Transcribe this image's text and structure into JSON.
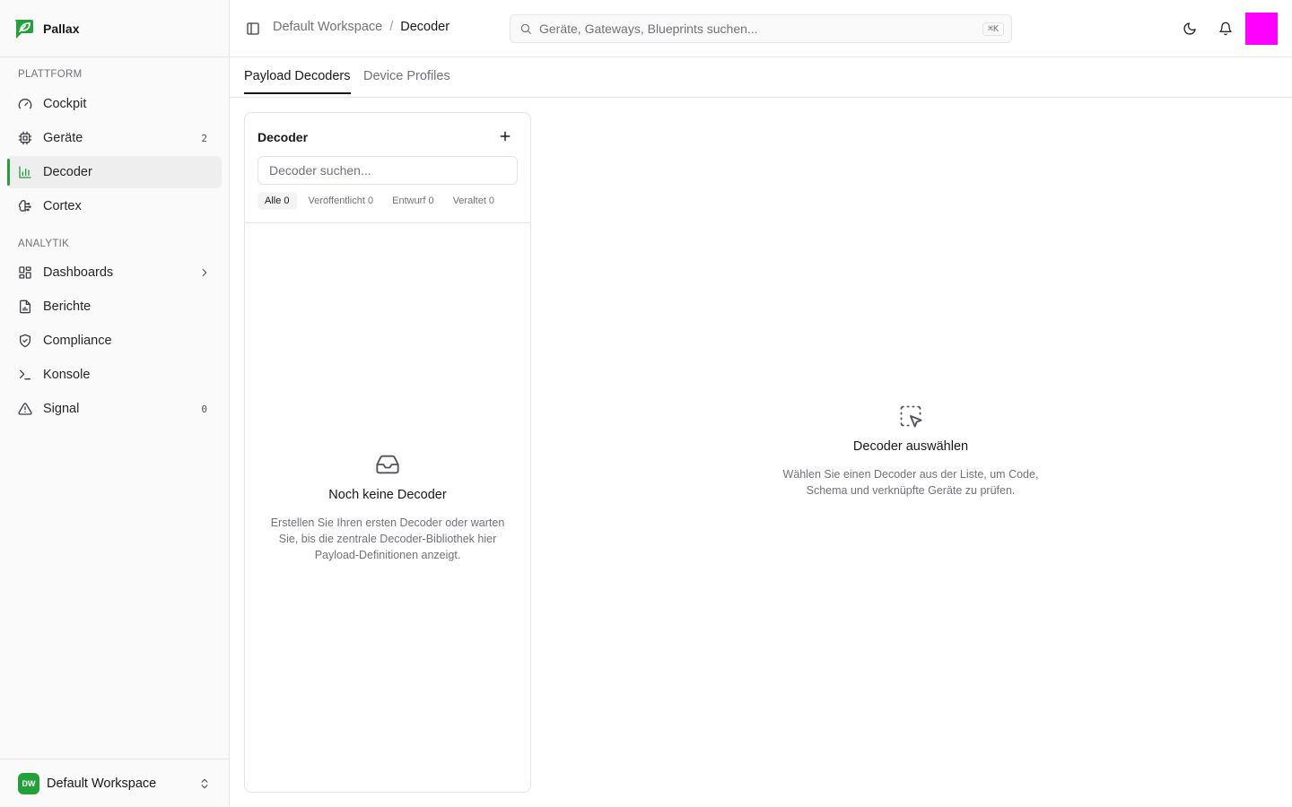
{
  "brand": {
    "name": "Pallax",
    "accent": "#22a13b"
  },
  "sidebar": {
    "sections": [
      {
        "label": "PLATTFORM"
      },
      {
        "label": "ANALYTIK"
      }
    ],
    "items": [
      {
        "label": "Cockpit",
        "icon": "gauge-icon"
      },
      {
        "label": "Geräte",
        "icon": "chip-icon",
        "count": "2"
      },
      {
        "label": "Decoder",
        "icon": "bar-chart-icon",
        "active": true
      },
      {
        "label": "Cortex",
        "icon": "brain-icon"
      },
      {
        "label": "Dashboards",
        "icon": "grid-icon"
      },
      {
        "label": "Berichte",
        "icon": "file-report-icon"
      },
      {
        "label": "Compliance",
        "icon": "shield-check-icon"
      },
      {
        "label": "Konsole",
        "icon": "terminal-icon"
      },
      {
        "label": "Signal",
        "icon": "warning-icon",
        "count": "0"
      }
    ],
    "workspace": {
      "initials": "DW",
      "name": "Default Workspace"
    }
  },
  "header": {
    "breadcrumb": [
      "Default Workspace",
      "Decoder"
    ],
    "breadcrumb_separator": "/",
    "search_placeholder": "Geräte, Gateways, Blueprints suchen...",
    "search_shortcut": "⌘K",
    "avatar_color": "#ff00ff"
  },
  "tabs": [
    {
      "label": "Payload Decoders",
      "active": true
    },
    {
      "label": "Device Profiles"
    }
  ],
  "decoder_panel": {
    "title": "Decoder",
    "search_placeholder": "Decoder suchen...",
    "filters": [
      "Alle 0",
      "Veröffentlicht 0",
      "Entwurf 0",
      "Veraltet 0"
    ],
    "empty_title": "Noch keine Decoder",
    "empty_description": "Erstellen Sie Ihren ersten Decoder oder warten Sie, bis die zentrale Decoder-Bibliothek hier Payload-Definitionen anzeigt."
  },
  "detail": {
    "title": "Decoder auswählen",
    "description": "Wählen Sie einen Decoder aus der Liste, um Code, Schema und verknüpfte Geräte zu prüfen."
  }
}
